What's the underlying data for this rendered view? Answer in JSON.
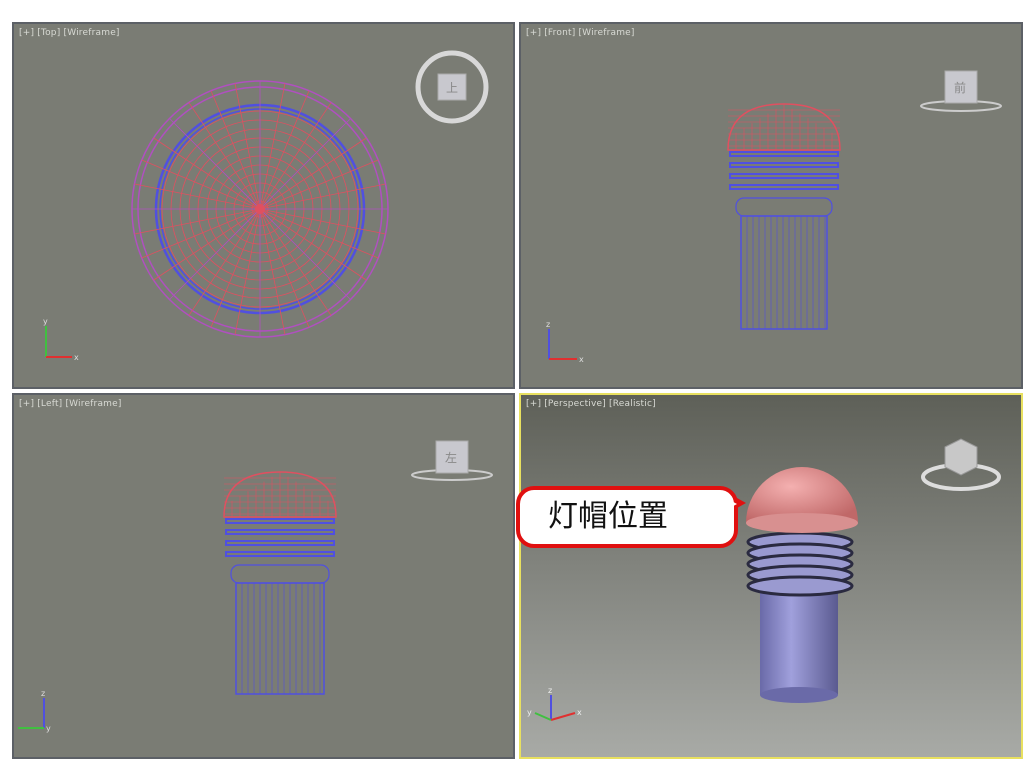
{
  "viewports": {
    "top": {
      "label": "[+] [Top] [Wireframe]",
      "cube": "上"
    },
    "front": {
      "label": "[+] [Front] [Wireframe]",
      "cube": "前"
    },
    "left": {
      "label": "[+] [Left] [Wireframe]",
      "cube": "左"
    },
    "perspective": {
      "label": "[+] [Perspective] [Realistic]"
    }
  },
  "callout": {
    "text": "灯帽位置"
  },
  "axes": {
    "x": "x",
    "y": "y",
    "z": "z"
  },
  "colors": {
    "wire_red": "#e05060",
    "wire_blue": "#5050e0",
    "active_border": "#e8e060",
    "callout_border": "#e01010",
    "cap": "#e89090",
    "body": "#8888cc"
  }
}
